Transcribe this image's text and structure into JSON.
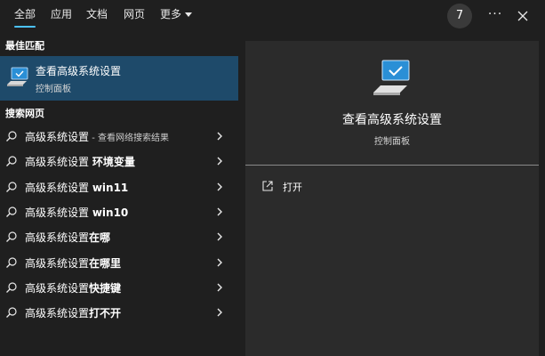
{
  "tabs": [
    {
      "label": "全部"
    },
    {
      "label": "应用"
    },
    {
      "label": "文档"
    },
    {
      "label": "网页"
    },
    {
      "label": "更多"
    }
  ],
  "rewards_count": "7",
  "more_options": "···",
  "best_match": {
    "section_title": "最佳匹配",
    "title": "查看高级系统设置",
    "subtitle": "控制面板"
  },
  "web_search": {
    "section_title": "搜索网页",
    "items": [
      {
        "base": "高级系统设置",
        "suffix": " - 查看网络搜索结果",
        "suffix_style": "sub"
      },
      {
        "base": "高级系统设置 ",
        "suffix": "环境变量",
        "suffix_style": "bold"
      },
      {
        "base": "高级系统设置 ",
        "suffix": "win11",
        "suffix_style": "bold"
      },
      {
        "base": "高级系统设置 ",
        "suffix": "win10",
        "suffix_style": "bold"
      },
      {
        "base": "高级系统设置",
        "suffix": "在哪",
        "suffix_style": "bold"
      },
      {
        "base": "高级系统设置",
        "suffix": "在哪里",
        "suffix_style": "bold"
      },
      {
        "base": "高级系统设置",
        "suffix": "快捷键",
        "suffix_style": "bold"
      },
      {
        "base": "高级系统设置",
        "suffix": "打不开",
        "suffix_style": "bold"
      }
    ]
  },
  "preview": {
    "title": "查看高级系统设置",
    "subtitle": "控制面板",
    "action_open": "打开"
  },
  "colors": {
    "accent": "#4cc2ff",
    "selected_bg": "#1e4a6a",
    "panel_bg": "#2b2b2b",
    "window_bg": "#1f1f1f"
  }
}
